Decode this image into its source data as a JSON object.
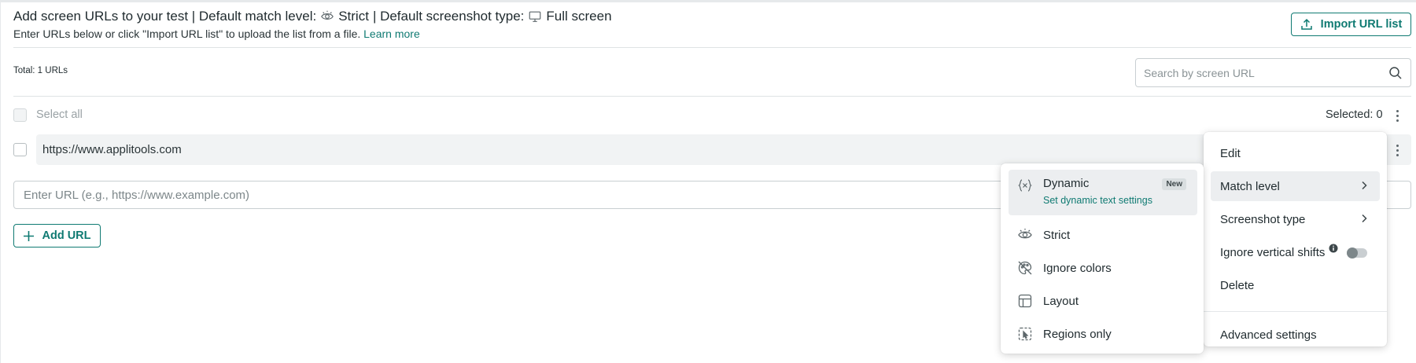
{
  "header": {
    "title_part1": "Add screen URLs to your test | Default match level:",
    "match_level": "Strict",
    "title_sep": "| Default screenshot type:",
    "screenshot_type": "Full screen",
    "subtitle": "Enter URLs below or click \"Import URL list\" to upload the list from a file.",
    "learn_more": "Learn more",
    "match_icon": "eye-icon",
    "screenshot_icon": "monitor-icon"
  },
  "import_button": {
    "label": "Import URL list",
    "icon": "upload-icon"
  },
  "toolbar": {
    "total": "Total: 1 URLs",
    "search_placeholder": "Search by screen URL",
    "search_icon": "search-icon"
  },
  "list": {
    "select_all": "Select all",
    "selected": "Selected: 0",
    "rows": [
      {
        "url": "https://www.applitools.com"
      }
    ],
    "new_url_placeholder": "Enter URL (e.g., https://www.example.com)",
    "add_url": "Add URL"
  },
  "context_menu": {
    "items": [
      {
        "label": "Edit"
      },
      {
        "label": "Match level",
        "has_submenu": true
      },
      {
        "label": "Screenshot type",
        "has_submenu": true
      },
      {
        "label": "Ignore vertical shifts",
        "toggle": false
      },
      {
        "label": "Delete"
      }
    ],
    "advanced": "Advanced settings"
  },
  "match_submenu": {
    "items": [
      {
        "label": "Dynamic",
        "sublabel": "Set dynamic text settings",
        "badge": "New",
        "icon": "variable-icon"
      },
      {
        "label": "Strict",
        "icon": "eye-icon"
      },
      {
        "label": "Ignore colors",
        "icon": "palette-off-icon"
      },
      {
        "label": "Layout",
        "icon": "layout-icon"
      },
      {
        "label": "Regions only",
        "icon": "region-select-icon"
      }
    ]
  },
  "colors": {
    "accent": "#0f7a72",
    "text": "#1f2a2e",
    "muted": "#9aa2a5",
    "row_bg": "#f1f3f4"
  }
}
